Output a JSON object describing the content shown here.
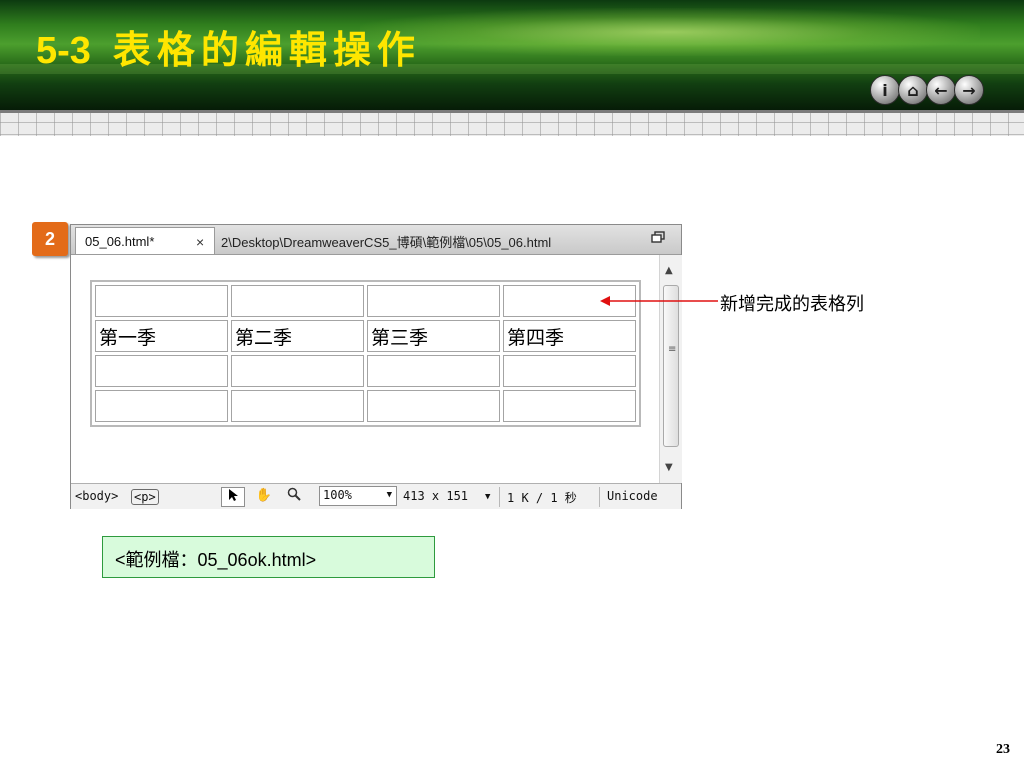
{
  "slide": {
    "title_number": "5-3",
    "title_text": "表格的編輯操作",
    "nav_buttons": [
      {
        "name": "info-icon",
        "glyph": "i"
      },
      {
        "name": "home-icon",
        "glyph": "⌂"
      },
      {
        "name": "back-arrow-icon",
        "glyph": "←"
      },
      {
        "name": "forward-arrow-icon",
        "glyph": "→"
      }
    ],
    "step_number": "2",
    "annotation": "新增完成的表格列",
    "example_file": "<範例檔：05_06ok.html>",
    "page_number": "23"
  },
  "dreamweaver": {
    "tab_label": "05_06.html*",
    "tab_close": "×",
    "file_path": "2\\Desktop\\DreamweaverCS5_博碩\\範例檔\\05\\05_06.html",
    "table_rows": [
      [
        "",
        "",
        "",
        ""
      ],
      [
        "第一季",
        "第二季",
        "第三季",
        "第四季"
      ],
      [
        "",
        "",
        "",
        ""
      ],
      [
        "",
        "",
        "",
        ""
      ]
    ],
    "status": {
      "tag_body": "<body>",
      "tag_p": "<p>",
      "zoom": "100%",
      "dimensions": "413 x 151",
      "file_size": "1 K / 1 秒",
      "encoding": "Unicode"
    }
  },
  "colors": {
    "title": "#ffe600",
    "header_green": "#2f7d1d",
    "step_badge": "#e36b19",
    "arrow": "#e01010",
    "example_bg": "#d8fbdc"
  }
}
